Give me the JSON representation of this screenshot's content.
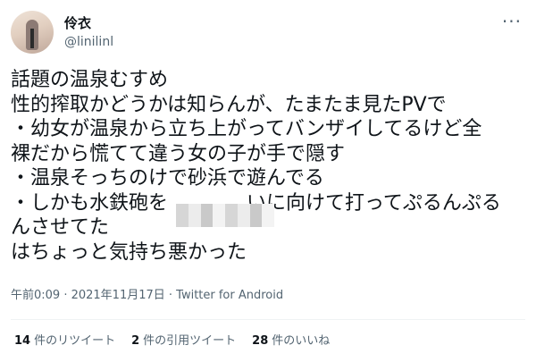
{
  "author": {
    "display_name": "伶衣",
    "handle": "@linilinl"
  },
  "tweet": {
    "text": "話題の温泉むすめ\n性的搾取かどうかは知らんが、たまたま見たPVで\n・幼女が温泉から立ち上がってバンザイしてるけど全\n裸だから慌てて違う女の子が手で隠す\n・温泉そっちのけで砂浜で遊んでる\n・しかも水鉄砲を　　　　いに向けて打ってぷるんぷる\nんさせてた\nはちょっと気持ち悪かった",
    "meta": "午前0:09 · 2021年11月17日 · Twitter for Android"
  },
  "stats": {
    "retweets": {
      "count": "14",
      "label": "件のリツイート"
    },
    "quotes": {
      "count": "2",
      "label": "件の引用ツイート"
    },
    "likes": {
      "count": "28",
      "label": "件のいいね"
    }
  },
  "icons": {
    "more": "more-horizontal-icon",
    "avatar": "profile-photo"
  }
}
